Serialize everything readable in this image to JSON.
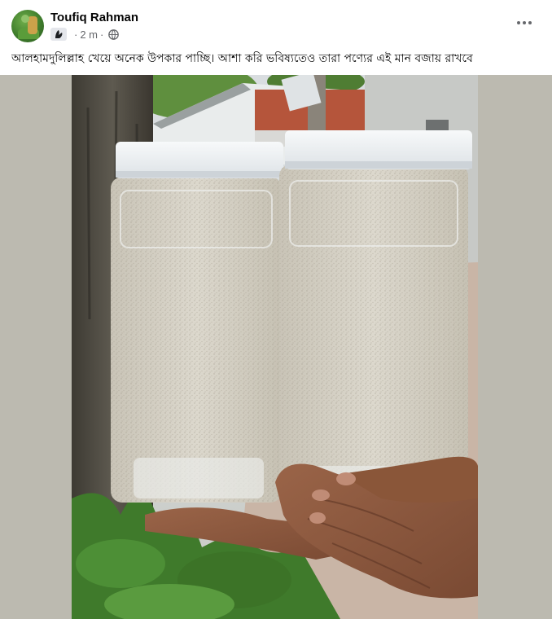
{
  "post": {
    "author": "Toufiq Rahman",
    "time": "2 m",
    "separator": "·",
    "caption": "আলহামদুলিল্লাহ খেয়ে অনেক উপকার পাচ্ছি। আশা করি ভবিষ্যতেও তারা পণ্যের এই মান বজায় রাখবে"
  },
  "icons": {
    "audience": "globe-icon",
    "badge": "group-badge-icon",
    "more": "more-options-icon"
  },
  "colors": {
    "frame_background": "#bcbab0",
    "text_primary": "#050505",
    "text_secondary": "#65676b",
    "lid": "#eef1f4",
    "powder": "#d7d3c8"
  },
  "photo": {
    "subject": "two-plastic-jars-of-powder-held-in-hands"
  }
}
